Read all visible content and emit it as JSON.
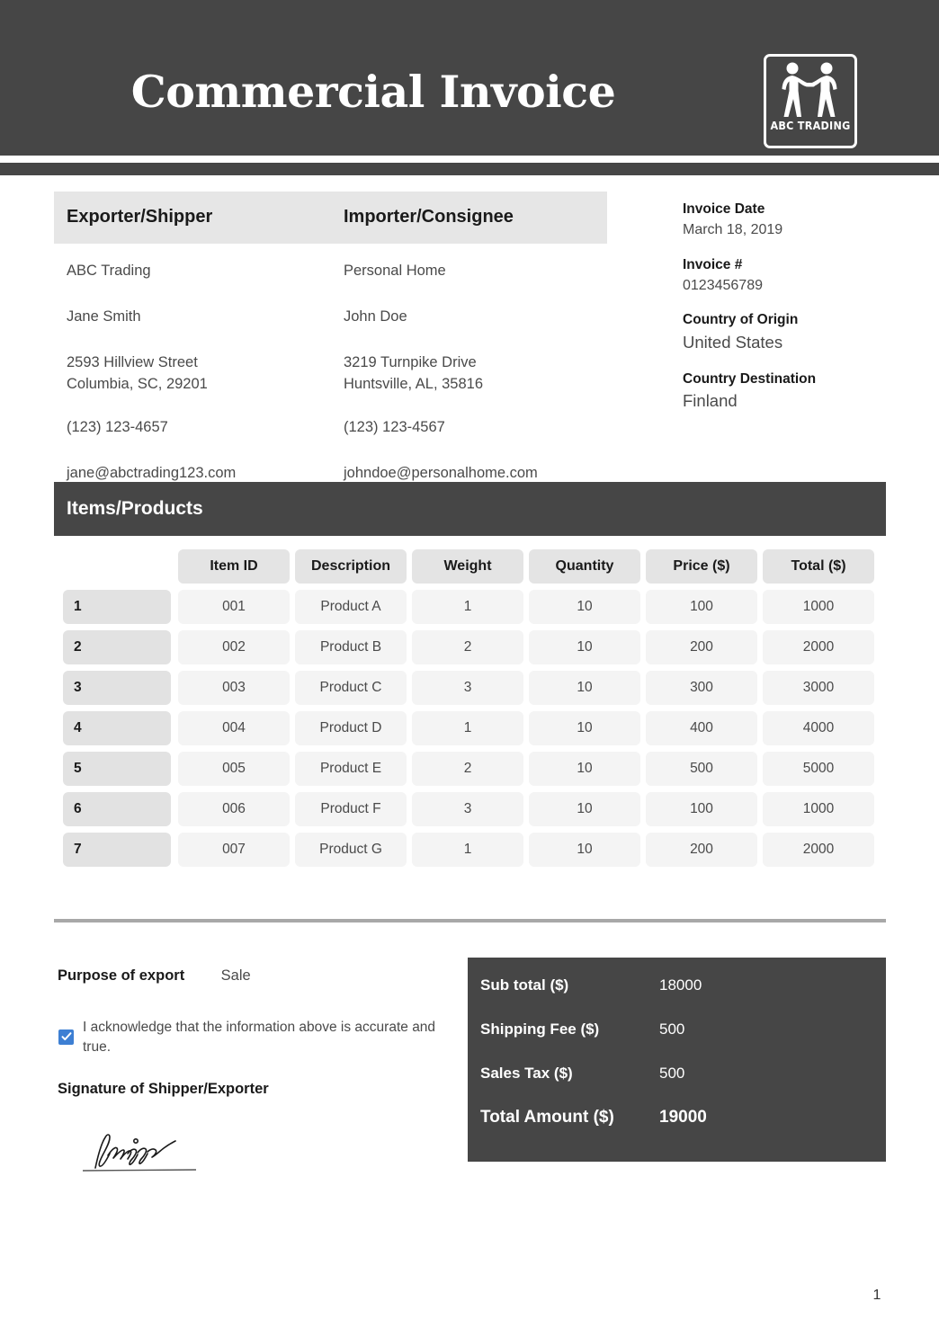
{
  "header": {
    "title": "Commercial Invoice",
    "logo_word": "ABC TRADING"
  },
  "parties": {
    "exporter_heading": "Exporter/Shipper",
    "importer_heading": "Importer/Consignee",
    "exporter": {
      "company": "ABC Trading",
      "contact": "Jane Smith",
      "street": "2593 Hillview Street",
      "city": "Columbia, SC, 29201",
      "phone": "(123) 123-4657",
      "email": "jane@abctrading123.com"
    },
    "importer": {
      "company": "Personal Home",
      "contact": "John Doe",
      "street": "3219 Turnpike Drive",
      "city": "Huntsville, AL, 35816",
      "phone": "(123) 123-4567",
      "email": "johndoe@personalhome.com"
    }
  },
  "invoice_info": {
    "date_label": "Invoice Date",
    "date_value": "March 18, 2019",
    "number_label": "Invoice #",
    "number_value": "0123456789",
    "origin_label": "Country of Origin",
    "origin_value": "United States",
    "destination_label": "Country Destination",
    "destination_value": "Finland"
  },
  "items": {
    "banner_label": "Items/Products",
    "columns": [
      "Item ID",
      "Description",
      "Weight",
      "Quantity",
      "Price ($)",
      "Total ($)"
    ],
    "rows": [
      {
        "idx": "1",
        "item_id": "001",
        "description": "Product A",
        "weight": "1",
        "quantity": "10",
        "price": "100",
        "total": "1000"
      },
      {
        "idx": "2",
        "item_id": "002",
        "description": "Product B",
        "weight": "2",
        "quantity": "10",
        "price": "200",
        "total": "2000"
      },
      {
        "idx": "3",
        "item_id": "003",
        "description": "Product C",
        "weight": "3",
        "quantity": "10",
        "price": "300",
        "total": "3000"
      },
      {
        "idx": "4",
        "item_id": "004",
        "description": "Product D",
        "weight": "1",
        "quantity": "10",
        "price": "400",
        "total": "4000"
      },
      {
        "idx": "5",
        "item_id": "005",
        "description": "Product E",
        "weight": "2",
        "quantity": "10",
        "price": "500",
        "total": "5000"
      },
      {
        "idx": "6",
        "item_id": "006",
        "description": "Product F",
        "weight": "3",
        "quantity": "10",
        "price": "100",
        "total": "1000"
      },
      {
        "idx": "7",
        "item_id": "007",
        "description": "Product G",
        "weight": "1",
        "quantity": "10",
        "price": "200",
        "total": "2000"
      }
    ]
  },
  "declaration": {
    "purpose_label": "Purpose of export",
    "purpose_value": "Sale",
    "acknowledgement": "I acknowledge that the information above is accurate and true.",
    "acknowledged": true,
    "signature_label": "Signature of Shipper/Exporter"
  },
  "totals": {
    "rows": [
      {
        "label": "Sub total ($)",
        "value": "18000"
      },
      {
        "label": "Shipping Fee ($)",
        "value": "500"
      },
      {
        "label": "Sales Tax ($)",
        "value": "500"
      },
      {
        "label": "Total Amount ($)",
        "value": "19000"
      }
    ]
  },
  "footer": {
    "page_number": "1"
  },
  "colors": {
    "dark_bar": "#464646",
    "pill_header": "#e4e4e4",
    "pill_data": "#f4f4f4",
    "pill_index": "#e2e2e2",
    "checkbox_blue": "#3d7fd3",
    "divider": "#a8a8a8"
  }
}
